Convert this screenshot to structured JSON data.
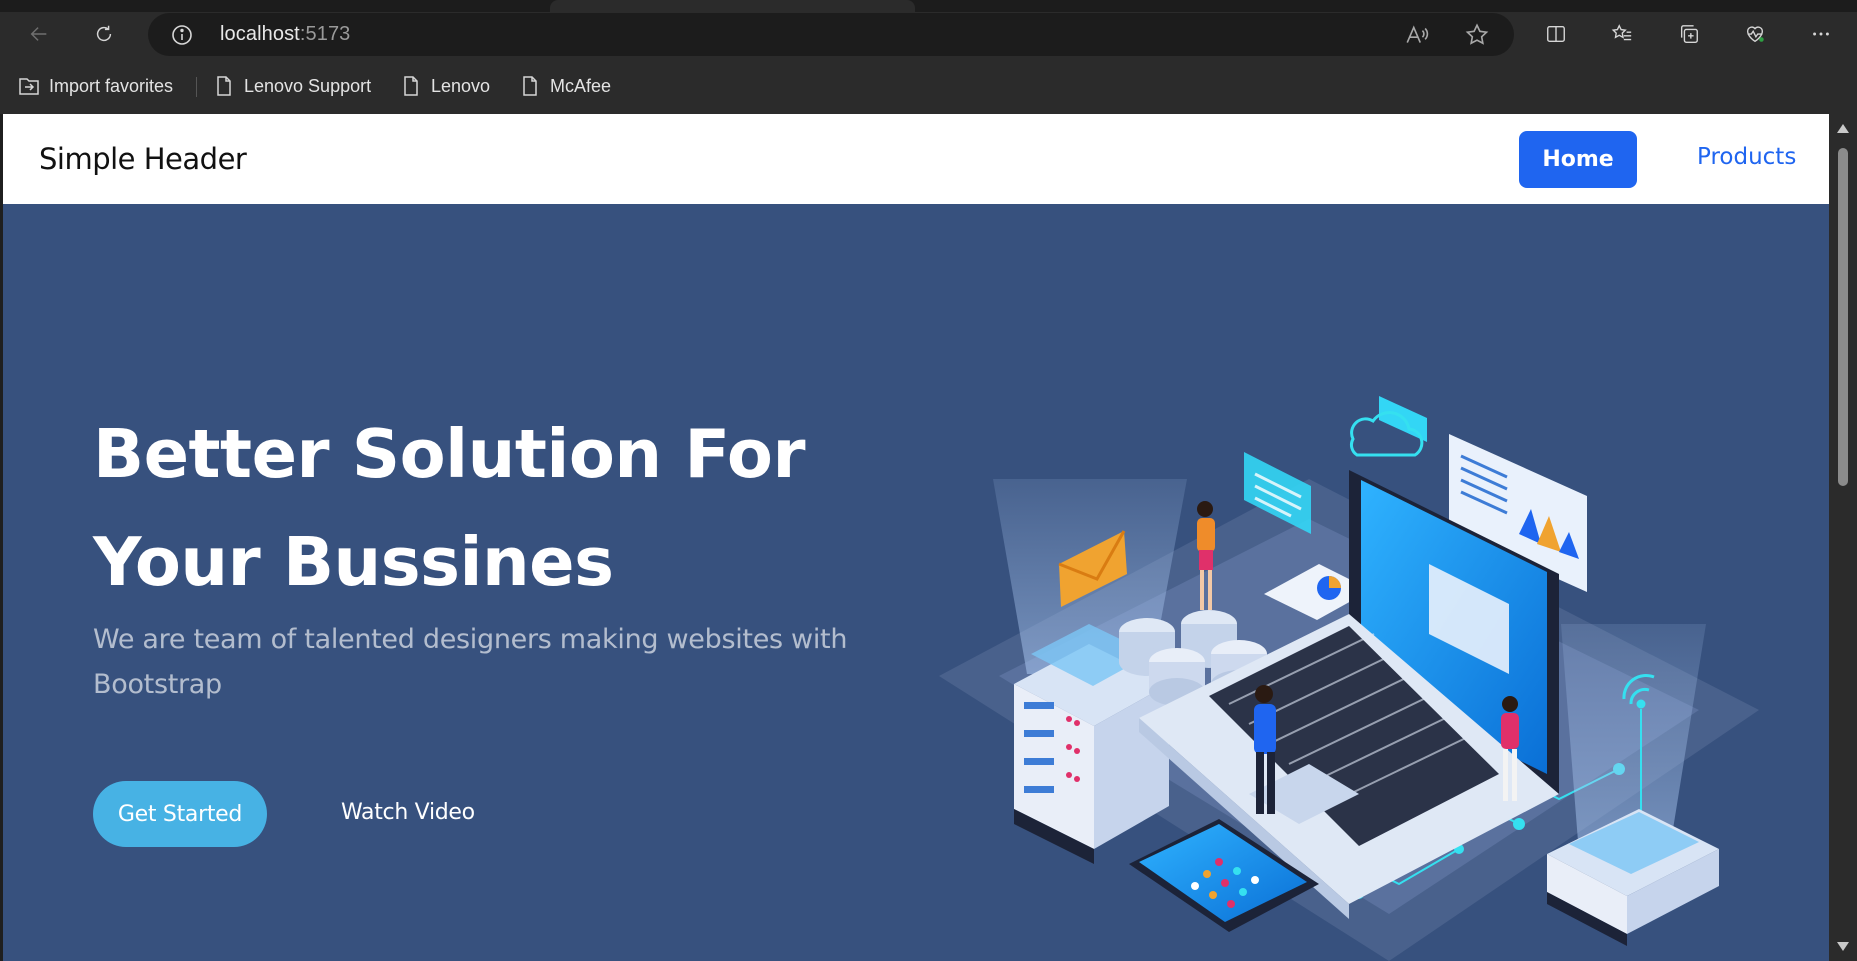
{
  "browser": {
    "address": {
      "host": "localhost",
      "port": ":5173"
    },
    "bookmarks": [
      {
        "label": "Import favorites",
        "icon": "import-favorites-icon"
      },
      {
        "label": "Lenovo Support",
        "icon": "page-icon"
      },
      {
        "label": "Lenovo",
        "icon": "page-icon"
      },
      {
        "label": "McAfee",
        "icon": "page-icon"
      }
    ]
  },
  "site": {
    "brand": "Simple Header",
    "nav": {
      "home": "Home",
      "products": "Products"
    },
    "hero": {
      "title_line1": "Better Solution For",
      "title_line2": "Your Bussines",
      "subtitle_line1": "We are team of talented designers making websites with",
      "subtitle_line2": "Bootstrap",
      "primary_button": "Get Started",
      "secondary_button": "Watch Video"
    }
  },
  "colors": {
    "hero_bg": "#37517e",
    "nav_active": "#1f65f0",
    "cta": "#47b2e4"
  }
}
